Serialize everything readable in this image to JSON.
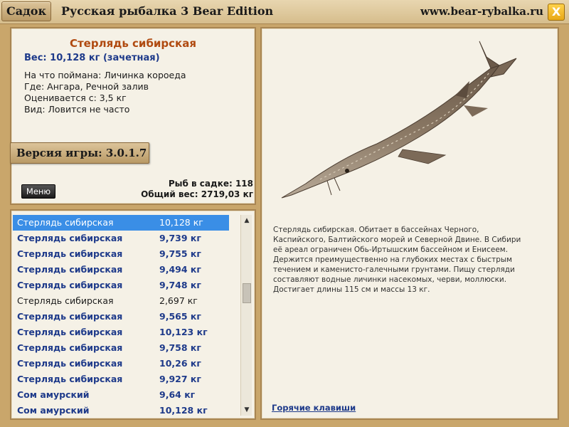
{
  "topbar": {
    "tab_label": "Садок",
    "app_title": "Русская рыбалка 3 Bear Edition",
    "site_url": "www.bear-rybalka.ru",
    "close_label": "X"
  },
  "info": {
    "fish_name": "Стерлядь сибирская",
    "weight": "Вес: 10,128 кг (зачетная)",
    "lines": [
      "На что поймана: Личинка короеда",
      "Где: Ангара, Речной залив",
      "Оценивается с: 3,5 кг",
      "Вид: Ловится не часто"
    ],
    "version": "Версия игры: 3.0.1.7",
    "menu_label": "Меню",
    "fish_count": "Рыб в садке: 118",
    "total_weight": "Общий вес: 2719,03 кг"
  },
  "list": [
    {
      "name": "Стерлядь сибирская",
      "weight": "10,128 кг",
      "style": "selected"
    },
    {
      "name": "Стерлядь сибирская",
      "weight": "9,739 кг",
      "style": "bold"
    },
    {
      "name": "Стерлядь сибирская",
      "weight": "9,755 кг",
      "style": "bold"
    },
    {
      "name": "Стерлядь сибирская",
      "weight": "9,494 кг",
      "style": "bold"
    },
    {
      "name": "Стерлядь сибирская",
      "weight": "9,748 кг",
      "style": "bold"
    },
    {
      "name": "Стерлядь сибирская",
      "weight": "2,697 кг",
      "style": "plain"
    },
    {
      "name": "Стерлядь сибирская",
      "weight": "9,565 кг",
      "style": "bold"
    },
    {
      "name": "Стерлядь сибирская",
      "weight": "10,123 кг",
      "style": "bold"
    },
    {
      "name": "Стерлядь сибирская",
      "weight": "9,758 кг",
      "style": "bold"
    },
    {
      "name": "Стерлядь сибирская",
      "weight": "10,26 кг",
      "style": "bold"
    },
    {
      "name": "Стерлядь сибирская",
      "weight": "9,927 кг",
      "style": "bold"
    },
    {
      "name": "Сом амурский",
      "weight": "9,64 кг",
      "style": "bold"
    },
    {
      "name": "Сом амурский",
      "weight": "10,128 кг",
      "style": "bold"
    }
  ],
  "scroll": {
    "position": 0.36
  },
  "detail": {
    "description": "Стерлядь сибирская. Обитает в бассейнах Черного, Каспийского, Балтийского морей и Северной Двине. В Сибири её ареал ограничен Обь-Иртышским бассейном и Енисеем. Держится преимущественно на глубоких местах с быстрым течением и каменисто-галечными грунтами. Пищу стерляди составляют водные личинки насекомых, черви, моллюски. Достигает длины 115 см и массы 13 кг.",
    "hotkeys_label": "Горячие клавиши",
    "image_name": "sterlet-fish-illustration"
  },
  "colors": {
    "accent_name": "#b04a10",
    "list_text": "#1e3a8a",
    "selection": "#3a8ee6",
    "panel_bg": "#f5f1e6",
    "frame": "#c9a66b"
  }
}
